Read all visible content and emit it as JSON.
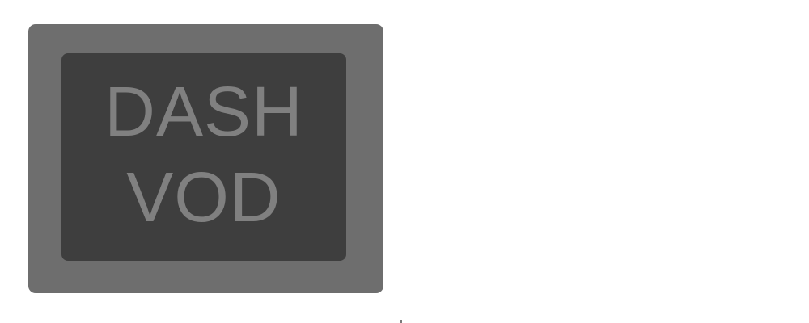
{
  "tile": {
    "line1": "DASH",
    "line2": "VOD"
  },
  "colors": {
    "background": "#ffffff",
    "tile_outer": "#6e6e6e",
    "tile_inner": "#3e3e3e",
    "tile_text": "#808080"
  }
}
